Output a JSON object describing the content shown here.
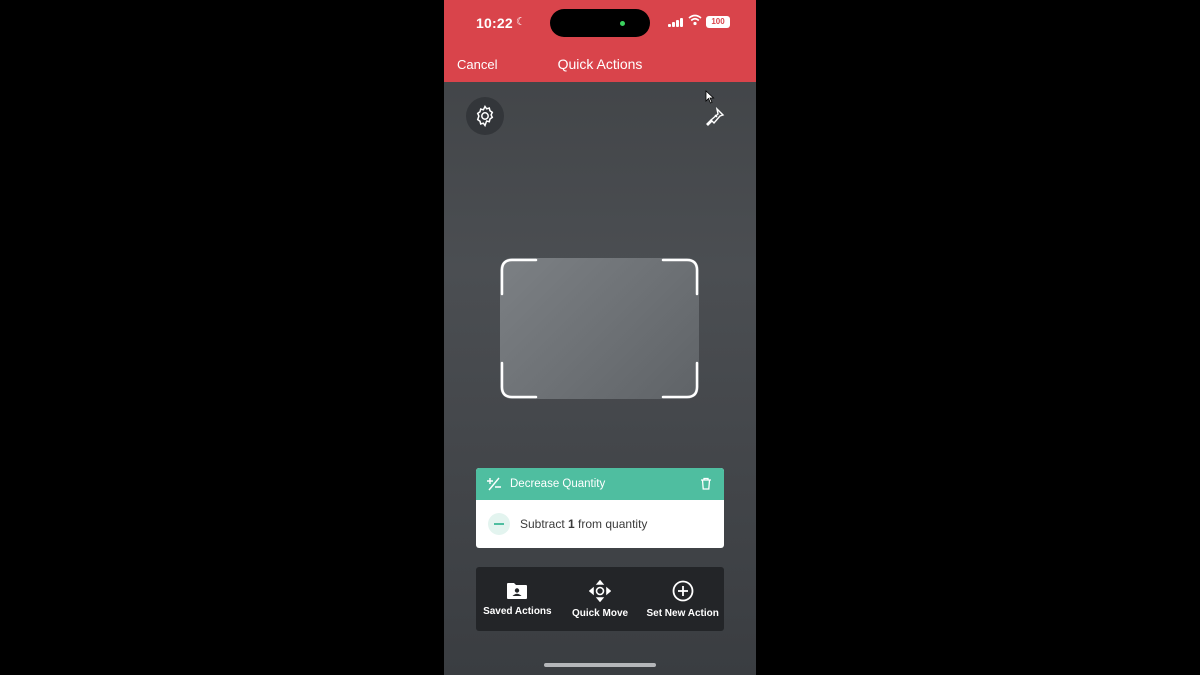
{
  "status_bar": {
    "time": "10:22",
    "battery": "100"
  },
  "header": {
    "cancel_label": "Cancel",
    "title": "Quick Actions"
  },
  "camera": {
    "settings_icon": "gear-icon",
    "flashlight_icon": "flashlight-icon"
  },
  "action_card": {
    "title": "Decrease Quantity",
    "body_prefix": "Subtract ",
    "body_amount": "1",
    "body_suffix": " from quantity"
  },
  "toolbar": {
    "saved_actions": "Saved Actions",
    "quick_move": "Quick Move",
    "set_new_action": "Set New Action"
  },
  "colors": {
    "header": "#d9444b",
    "accent": "#4fbea0"
  }
}
